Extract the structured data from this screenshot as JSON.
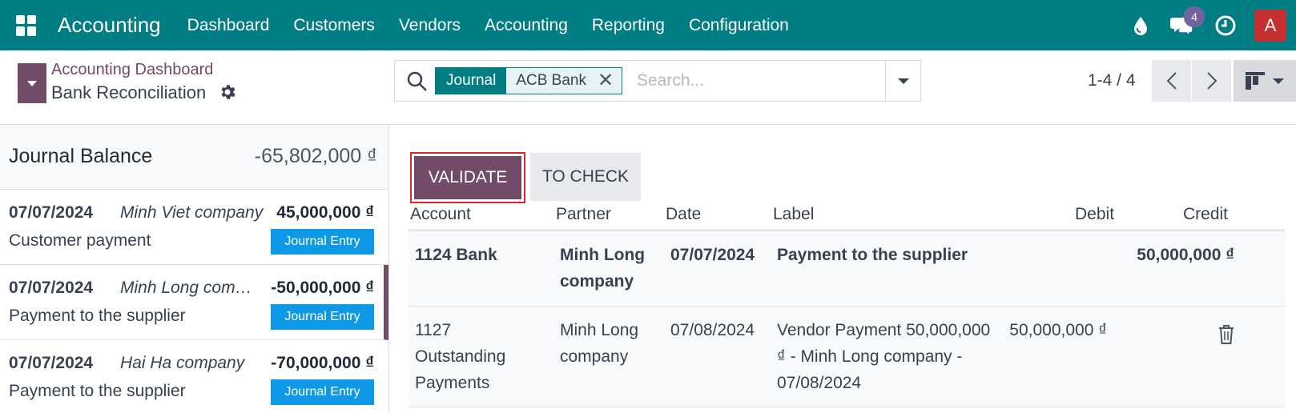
{
  "navbar": {
    "app_name": "Accounting",
    "menu": [
      "Dashboard",
      "Customers",
      "Vendors",
      "Accounting",
      "Reporting",
      "Configuration"
    ],
    "chat_badge": "4",
    "avatar_letter": "A",
    "bg_color": "#017e84"
  },
  "control_panel": {
    "breadcrumb_parent": "Accounting Dashboard",
    "breadcrumb_current": "Bank Reconciliation",
    "facet_label": "Journal",
    "facet_value": "ACB Bank",
    "search_placeholder": "Search...",
    "pager": "1-4 / 4"
  },
  "left_panel": {
    "journal_balance_label": "Journal Balance",
    "journal_balance_value": "-65,802,000 ₫",
    "lines": [
      {
        "date": "07/07/2024",
        "partner": "Minh Viet company",
        "amount": "45,000,000 ₫",
        "label": "Customer payment",
        "button": "Journal Entry"
      },
      {
        "date": "07/07/2024",
        "partner": "Minh Long company",
        "amount": "-50,000,000 ₫",
        "label": "Payment to the supplier",
        "button": "Journal Entry"
      },
      {
        "date": "07/07/2024",
        "partner": "Hai Ha company",
        "amount": "-70,000,000 ₫",
        "label": "Payment to the supplier",
        "button": "Journal Entry"
      }
    ]
  },
  "right_panel": {
    "validate_label": "VALIDATE",
    "to_check_label": "TO CHECK",
    "columns": [
      "Account",
      "Partner",
      "Date",
      "Label",
      "Debit",
      "Credit"
    ],
    "rows": [
      {
        "account": "1124 Bank",
        "partner": "Minh Long company",
        "date": "07/07/2024",
        "label": "Payment to the supplier",
        "debit": "",
        "credit": "50,000,000 ₫"
      },
      {
        "account": "1127 Outstanding Payments",
        "partner": "Minh Long company",
        "date": "07/08/2024",
        "label": "Vendor Payment 50,000,000 ₫ - Minh Long company - 07/08/2024",
        "debit": "50,000,000 ₫",
        "credit": ""
      }
    ]
  },
  "colors": {
    "primary": "#714b67",
    "teal": "#017e84",
    "info": "#0d99e6",
    "highlight": "#e0262b"
  }
}
